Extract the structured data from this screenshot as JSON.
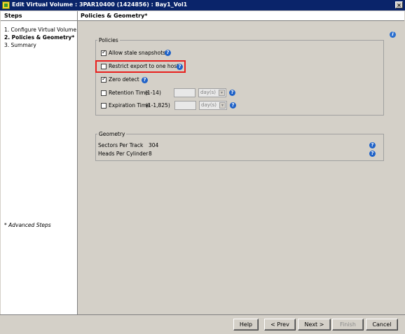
{
  "window": {
    "title": "Edit Virtual Volume : 3PAR10400 (1424856) : Bay1_Vol1",
    "close": "×"
  },
  "steps": {
    "header": "Steps",
    "items": [
      "1. Configure Virtual Volume",
      "2. Policies & Geometry*",
      "3. Summary"
    ],
    "advanced": "* Advanced Steps"
  },
  "main": {
    "header": "Policies & Geometry*",
    "policies": {
      "legend": "Policies",
      "allow_stale": {
        "label": "Allow stale snapshots",
        "checked": true
      },
      "restrict_export": {
        "label": "Restrict export to one host",
        "checked": false
      },
      "zero_detect": {
        "label": "Zero detect",
        "checked": true
      },
      "retention": {
        "label": "Retention Time",
        "range": "(1-14)",
        "value": "",
        "unit": "day(s)",
        "checked": false
      },
      "expiration": {
        "label": "Expiration Time",
        "range": "(1-1,825)",
        "value": "",
        "unit": "day(s)",
        "checked": false
      }
    },
    "geometry": {
      "legend": "Geometry",
      "sectors_label": "Sectors Per Track",
      "sectors_value": "304",
      "heads_label": "Heads Per Cylinder",
      "heads_value": "8"
    }
  },
  "buttons": {
    "help": "Help",
    "prev": "< Prev",
    "next": "Next >",
    "finish": "Finish",
    "cancel": "Cancel"
  },
  "colors": {
    "titlebar": "#0a246a",
    "highlight": "#e8201e",
    "help_icon": "#1f62c8"
  }
}
